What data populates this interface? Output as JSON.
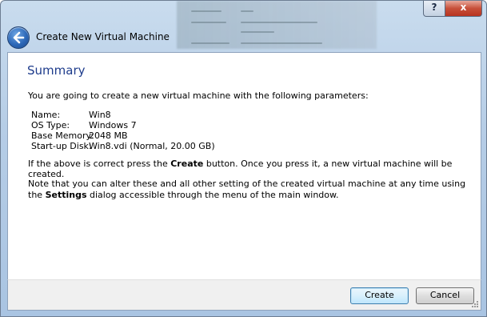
{
  "window": {
    "title": "Create New Virtual Machine",
    "help_glyph": "?",
    "close_glyph": "x"
  },
  "page": {
    "heading": "Summary",
    "intro": "You are going to create a new virtual machine with the following parameters:",
    "params": [
      {
        "label": "Name:",
        "value": "Win8"
      },
      {
        "label": "OS Type:",
        "value": "Windows 7"
      },
      {
        "label": "Base Memory:",
        "value": "2048 MB"
      },
      {
        "label": "Start-up Disk:",
        "value": "Win8.vdi (Normal, 20.00 GB)"
      }
    ],
    "confirm_prefix": "If the above is correct press the ",
    "confirm_bold": "Create",
    "confirm_suffix": " button. Once you press it, a new virtual machine will be created.",
    "note_prefix": "Note that you can alter these and all other setting of the created virtual machine at any time using the ",
    "note_bold": "Settings",
    "note_suffix": " dialog accessible through the menu of the main window."
  },
  "footer": {
    "create_label": "Create",
    "cancel_label": "Cancel"
  },
  "colors": {
    "heading": "#1e3c8c",
    "title_bar": "#b6cde6",
    "content_bg": "#ffffff",
    "footer_bg": "#f0f0f0"
  }
}
